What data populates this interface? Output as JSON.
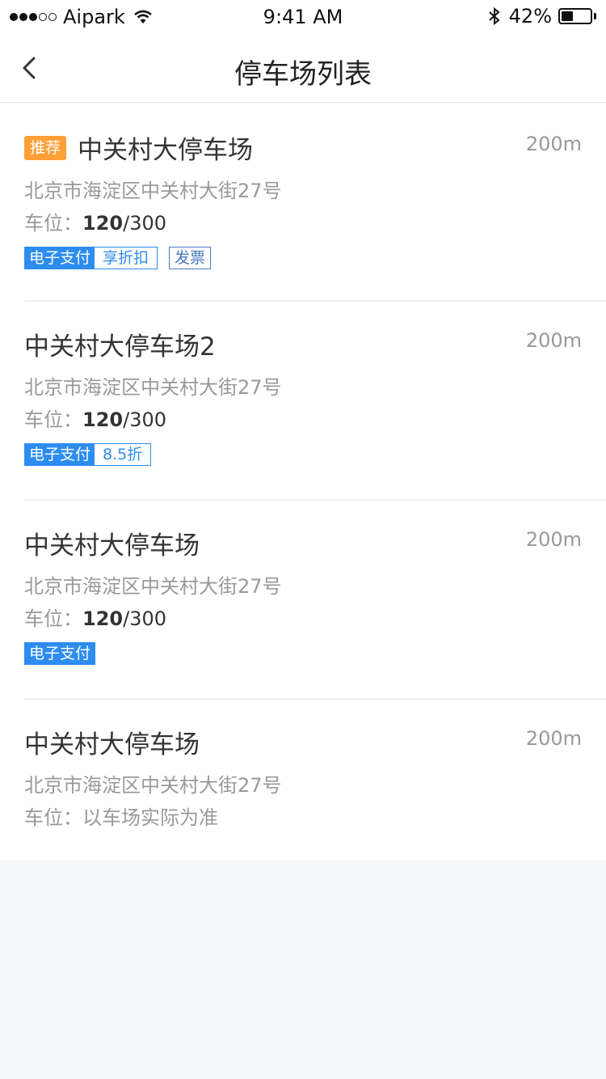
{
  "status": {
    "carrier": "Aipark",
    "time": "9:41 AM",
    "battery": "42%",
    "battery_level": 0.42
  },
  "nav": {
    "title": "停车场列表"
  },
  "colors": {
    "accent": "#2d8cf0",
    "recommend": "#ff9f36"
  },
  "items": [
    {
      "badge": "推荐",
      "name": "中关村大停车场",
      "distance": "200m",
      "address": "北京市海淀区中关村大街27号",
      "spaces_label": "车位：",
      "spaces_free": "120",
      "spaces_total": "/300",
      "tag_primary": "电子支付",
      "tag_secondary": "享折扣",
      "tag_extra": "发票"
    },
    {
      "name": "中关村大停车场2",
      "distance": "200m",
      "address": "北京市海淀区中关村大街27号",
      "spaces_label": "车位：",
      "spaces_free": "120",
      "spaces_total": "/300",
      "tag_primary": "电子支付",
      "tag_secondary": "8.5折"
    },
    {
      "name": "中关村大停车场",
      "distance": "200m",
      "address": "北京市海淀区中关村大街27号",
      "spaces_label": "车位：",
      "spaces_free": "120",
      "spaces_total": "/300",
      "tag_primary": "电子支付"
    },
    {
      "name": "中关村大停车场",
      "distance": "200m",
      "address": "北京市海淀区中关村大街27号",
      "spaces_text": "车位：以车场实际为准"
    }
  ]
}
